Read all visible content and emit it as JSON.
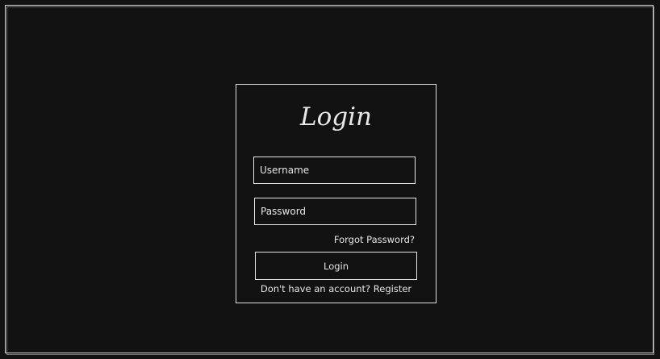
{
  "login": {
    "title": "Login",
    "username_placeholder": "Username",
    "password_placeholder": "Password",
    "forgot_label": "Forgot Password?",
    "button_label": "Login",
    "register_prompt": "Don't have an account?",
    "register_label": "Register"
  },
  "colors": {
    "background": "#121212",
    "stroke": "#e6e6e6"
  }
}
